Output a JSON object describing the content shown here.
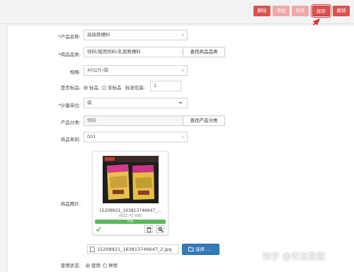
{
  "toolbar": {
    "delete": "删除",
    "add": "增加",
    "edit": "修改",
    "save": "保存",
    "cancel": "撤销"
  },
  "form": {
    "product_name": {
      "label": "*产品名称:",
      "value": "高级教槽料"
    },
    "category": {
      "label": "*商品品类:",
      "value": "饲料/猪用饲料/乳猪教槽料",
      "button": "查找商品品类"
    },
    "spec": {
      "label": "规格:",
      "value": "40公斤/袋"
    },
    "standard": {
      "label": "是否标品:",
      "opt_yes": "标品",
      "opt_no": "非标品",
      "pack_label": "标准包装:",
      "pack_value": "1"
    },
    "unit": {
      "label": "*计量单位:",
      "value": "袋"
    },
    "product_class": {
      "label": "产品分类:",
      "value": "饲料",
      "button": "查找产品分类"
    },
    "barcode": {
      "label": "商品条码:",
      "value": "001"
    },
    "image": {
      "label": "商品图片:",
      "file_name": "15208921_163813746647_...",
      "file_size": "(622.42 KB)",
      "progress_text": "完成",
      "progress": 1.0
    },
    "file_input": "15208921_163813746647_2.jpg",
    "browse_button": "选择 ...",
    "status": {
      "label": "使用状态:",
      "opt_on": "使用",
      "opt_off": "停用"
    }
  },
  "watermark": "知乎 @农信数据",
  "colors": {
    "danger": "#d9534f",
    "danger_disabled": "#eea8a7",
    "primary": "#337ab7",
    "success": "#5cb85c"
  }
}
